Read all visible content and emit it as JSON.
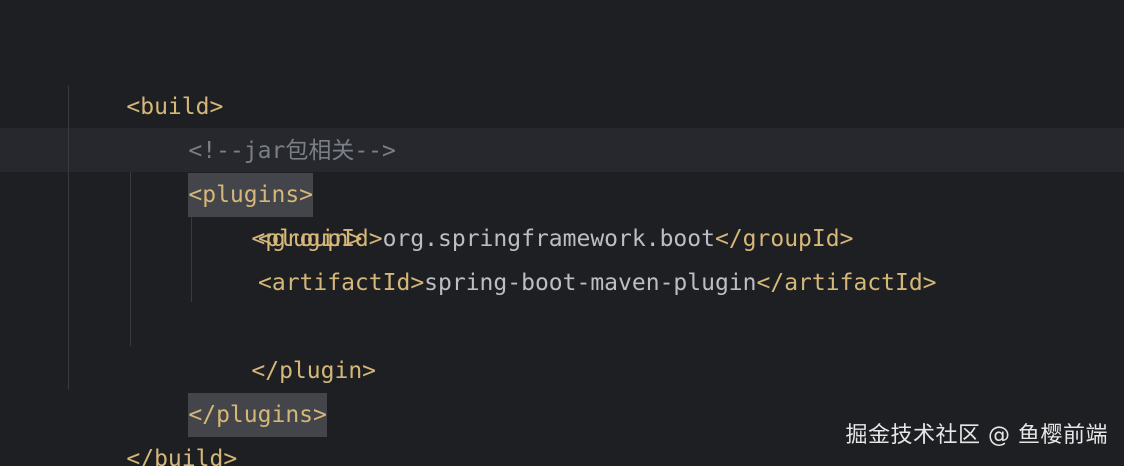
{
  "editor": {
    "language": "xml",
    "current_line": 3,
    "lines": [
      {
        "open_tag": "<build>"
      },
      {
        "comment": "<!--jar包相关-->"
      },
      {
        "open_tag": "<plugins>"
      },
      {
        "open_tag": "<plugin>"
      },
      {
        "open_tag": "<groupId>",
        "text": "org.springframework.boot",
        "close_tag": "</groupId>"
      },
      {
        "open_tag": "<artifactId>",
        "text": "spring-boot-maven-plugin",
        "close_tag": "</artifactId>"
      },
      {
        "close_tag": "</plugin>"
      },
      {
        "close_tag": "</plugins>"
      },
      {
        "close_tag": "</build>"
      }
    ]
  },
  "watermark": "掘金技术社区 @ 鱼樱前端",
  "colors": {
    "background": "#1e1f22",
    "current_line": "#26282e",
    "tag": "#d5b778",
    "comment": "#7a7e85",
    "text": "#bcbec4",
    "bracket_match": "#43454a"
  }
}
